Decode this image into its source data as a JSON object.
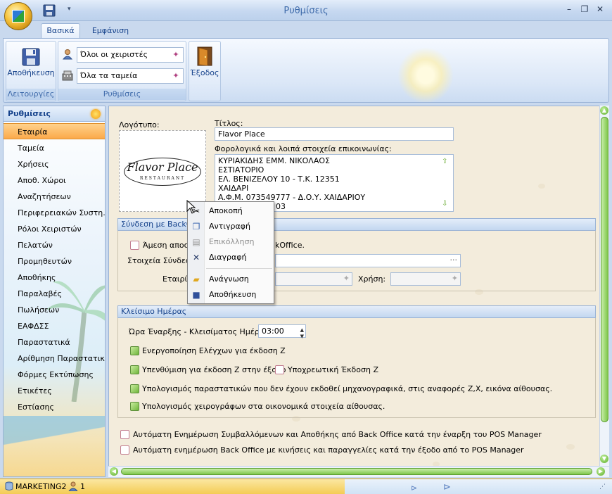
{
  "window": {
    "title": "Ρυθμίσεις",
    "minimize": "–",
    "restore": "❐",
    "close": "✕",
    "qat_dropdown": "▾"
  },
  "ribbon": {
    "tabs": [
      {
        "label": "Βασικά",
        "active": true
      },
      {
        "label": "Εμφάνιση",
        "active": false
      }
    ],
    "groups": {
      "functions": {
        "label": "Λειτουργίες",
        "save_label": "Αποθήκευση"
      },
      "settings": {
        "label": "Ρυθμίσεις",
        "users_combo": "Όλοι οι χειριστές",
        "registers_combo": "Όλα τα ταμεία"
      },
      "exit": {
        "label": "Έξοδος"
      }
    }
  },
  "nav": {
    "header": "Ρυθμίσεις",
    "items": [
      {
        "label": "Εταιρία",
        "selected": true
      },
      {
        "label": "Ταμεία"
      },
      {
        "label": "Χρήσεις"
      },
      {
        "label": "Αποθ. Χώροι"
      },
      {
        "label": "Αναζητήσεων"
      },
      {
        "label": "Περιφερειακών Συστη..."
      },
      {
        "label": "Ρόλοι Χειριστών"
      },
      {
        "label": "Πελατών"
      },
      {
        "label": "Προμηθευτών"
      },
      {
        "label": "Αποθήκης"
      },
      {
        "label": "Παραλαβές"
      },
      {
        "label": "Πωλήσεων"
      },
      {
        "label": "ΕΑΦΔΣΣ"
      },
      {
        "label": "Παραστατικά"
      },
      {
        "label": "Αρίθμηση Παραστατικών"
      },
      {
        "label": "Φόρμες Εκτύπωσης"
      },
      {
        "label": "Ετικέτες"
      },
      {
        "label": "Εστίασης"
      }
    ]
  },
  "company": {
    "logo_label": "Λογότυπο:",
    "logo_text": "Flavor Place",
    "logo_subtext": "RESTAURANT",
    "title_label": "Τίτλος:",
    "title_value": "Flavor Place",
    "details_label": "Φορολογικά και λοιπά στοιχεία επικοινωνίας:",
    "details_lines": [
      "ΚΥΡΙΑΚΙΔΗΣ ΕΜΜ. ΝΙΚΟΛΑΟΣ",
      "ΕΣΤΙΑΤΟΡΙΟ",
      "ΕΛ. ΒΕΝΙΖΕΛΟΥ 10 - Τ.Κ. 12351",
      "ΧΑΙΔΑΡΙ",
      "Α.Φ.Μ. 073549777 - Δ.Ο.Υ. ΧΑΙΔΑΡΙΟΥ",
      "03"
    ]
  },
  "backoffice": {
    "header": "Σύνδεση με BackOffic",
    "direct_send_label_a": "Άμεση αποστ",
    "direct_send_label_b": "kOffice.",
    "connection_label": "Στοιχεία Σύνδεσης",
    "ellipsis": "···",
    "company_label": "Εταιρία:",
    "fiscal_year_label": "Χρήση:"
  },
  "day_close": {
    "header": "Κλείσιμο Ημέρας",
    "time_label": "Ώρα Έναρξης - Κλεισίματος Ημέρας:",
    "time_value": "03:00",
    "checks": [
      {
        "label": "Ενεργοποίηση Ελέγχων για έκδοση Ζ",
        "checked": true
      },
      {
        "label": "Υπενθύμιση για έκδοση Ζ στην έξοδο",
        "checked": true
      },
      {
        "label": "Υποχρεωτική Έκδοση Ζ",
        "checked": false
      },
      {
        "label": "Υπολογισμός παραστατικών που δεν έχουν εκδοθεί μηχανογραφικά, στις αναφορές Ζ,Χ, εικόνα αίθουσας.",
        "checked": true
      },
      {
        "label": "Υπολογισμός χειρογράφων στα οικονομικά στοιχεία αίθουσας.",
        "checked": true
      }
    ]
  },
  "auto_updates": [
    {
      "label": "Αυτόματη Ενημέρωση Συμβαλλόμενων και Αποθήκης από Back Office κατά την έναρξη του POS Manager",
      "checked": false
    },
    {
      "label": "Αυτόματη ενημέρωση Back Office με κινήσεις και παραγγελίες κατά την έξοδο από το POS Manager",
      "checked": false
    }
  ],
  "context_menu": {
    "items": [
      {
        "label": "Αποκοπή",
        "icon": "scissors-icon",
        "enabled": true
      },
      {
        "label": "Αντιγραφή",
        "icon": "copy-icon",
        "enabled": true
      },
      {
        "label": "Επικόλληση",
        "icon": "paste-icon",
        "enabled": false
      },
      {
        "label": "Διαγραφή",
        "icon": "delete-icon",
        "enabled": true
      },
      {
        "label": "Ανάγνωση",
        "icon": "open-folder-icon",
        "enabled": true
      },
      {
        "label": "Αποθήκευση",
        "icon": "save-icon",
        "enabled": true
      }
    ]
  },
  "status": {
    "database": "MARKETING2",
    "users": "1"
  },
  "colors": {
    "accent": "#15428b",
    "nav_selected": "#fba94a",
    "status_bar": "#f4cc55"
  }
}
